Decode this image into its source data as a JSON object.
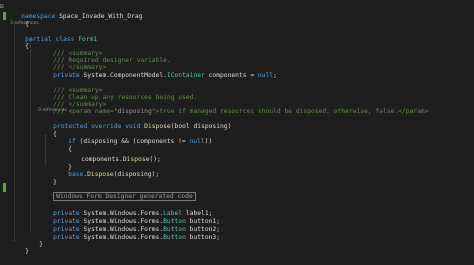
{
  "code": {
    "namespace_kw": "namespace",
    "namespace_name": " Space_Invade_With_Drag",
    "open_brace_1": "{",
    "ref_1": "3 references",
    "partial_kw": "partial",
    "class_kw": " class",
    "class_name": " Form1",
    "open_brace_2": "{",
    "summary1_open": "/// <summary>",
    "summary1_text": "/// Required designer variable.",
    "summary1_close": "/// </summary>",
    "private_kw": "private",
    "components_decl": " System.ComponentModel.",
    "icontainer": "IContainer",
    "components_rest": " components = ",
    "null_kw": "null",
    "semicolon": ";",
    "summary2_open": "/// <summary>",
    "summary2_text": "/// Clean up any resources being used.",
    "summary2_close": "/// </summary>",
    "param_prefix": "/// <param name=",
    "param_name": "\"disposing\"",
    "param_text": ">true if managed resources should be disposed; otherwise, false.</param>",
    "ref_2": "0 references",
    "protected_kw": "protected",
    "override_kw": " override",
    "void_kw": " void",
    "dispose_name": " Dispose",
    "dispose_params": "(bool disposing)",
    "open_brace_3": "{",
    "if_kw": "if",
    "if_cond": " (disposing && (components != ",
    "if_null": "null",
    "if_close": "))",
    "open_brace_4": "{",
    "components_dispose": "components.",
    "dispose_call": "Dispose",
    "dispose_call_args": "();",
    "close_brace_4": "}",
    "base_kw": "base",
    "base_call": ".",
    "base_dispose": "Dispose",
    "base_args": "(disposing);",
    "close_brace_3": "}",
    "region_label": "Windows Form Designer generated code",
    "field1_type_ns": " System.Windows.Forms.",
    "field1_type": "Label",
    "field1_name": " label1;",
    "field2_type_ns": " System.Windows.Forms.",
    "field2_type": "Button",
    "field2_name": " button1;",
    "field3_type_ns": " System.Windows.Forms.",
    "field3_type": "Button",
    "field3_name": " button2;",
    "field4_type_ns": " System.Windows.Forms.",
    "field4_type": "Button",
    "field4_name": " button3;",
    "close_brace_2": "}",
    "close_brace_1": "}"
  },
  "colors": {
    "background": "#1e1e1e",
    "keyword": "#569cd6",
    "type": "#4ec9b0",
    "comment": "#57a64a",
    "plain": "#dcdcdc",
    "method": "#dcdcaa"
  }
}
